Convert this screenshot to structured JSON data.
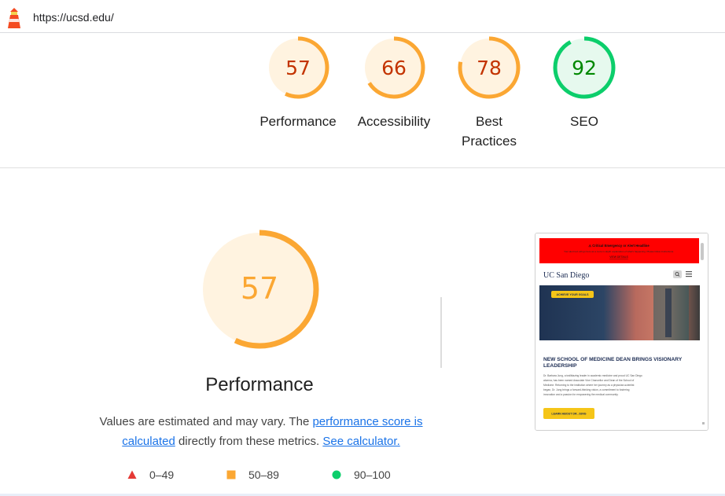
{
  "header": {
    "url": "https://ucsd.edu/"
  },
  "colors": {
    "fail": "#e53935",
    "average": "#fba733",
    "pass": "#0cce6b",
    "average_text": "#c33300",
    "pass_text": "#008800",
    "average_bg": "#fff3e0",
    "pass_bg": "#e6f9ee"
  },
  "gauges": [
    {
      "label": "Performance",
      "score": 57
    },
    {
      "label": "Accessibility",
      "score": 66
    },
    {
      "label": "Best Practices",
      "score": 78
    },
    {
      "label": "SEO",
      "score": 92
    }
  ],
  "main": {
    "score": 57,
    "title": "Performance",
    "desc_part1": "Values are estimated and may vary. The ",
    "desc_link1": "performance score is calculated",
    "desc_part2": " directly from these metrics. ",
    "desc_link2": "See calculator."
  },
  "legend": [
    {
      "shape": "triangle",
      "range": "0–49"
    },
    {
      "shape": "square",
      "range": "50–89"
    },
    {
      "shape": "circle",
      "range": "90–100"
    }
  ],
  "screenshot": {
    "alert_title": "⚠ Critical Emergency or Alert Headline",
    "alert_text": "Your alert text will go here as a more in-depth explanation of what's happening. Please follow instructions.",
    "alert_link": "VIEW DETAILS",
    "brand": "UC San Diego",
    "hero_badge": "ACHIEVE YOUR GOALS",
    "headline": "NEW SCHOOL OF MEDICINE DEAN BRINGS VISIONARY LEADERSHIP",
    "body": "Dr. Barbara Jung, a trailblazing leader in academic medicine and proud UC San Diego alumna, has been named Associate Vice Chancellor and Dean of the School of Medicine. Returning to the institution where her journey as a physician-scientist began, Dr. Jung brings a forward-thinking vision, a commitment to fostering innovation and a passion for empowering the medical community.",
    "cta": "LEARN ABOUT DR. JUNG"
  }
}
